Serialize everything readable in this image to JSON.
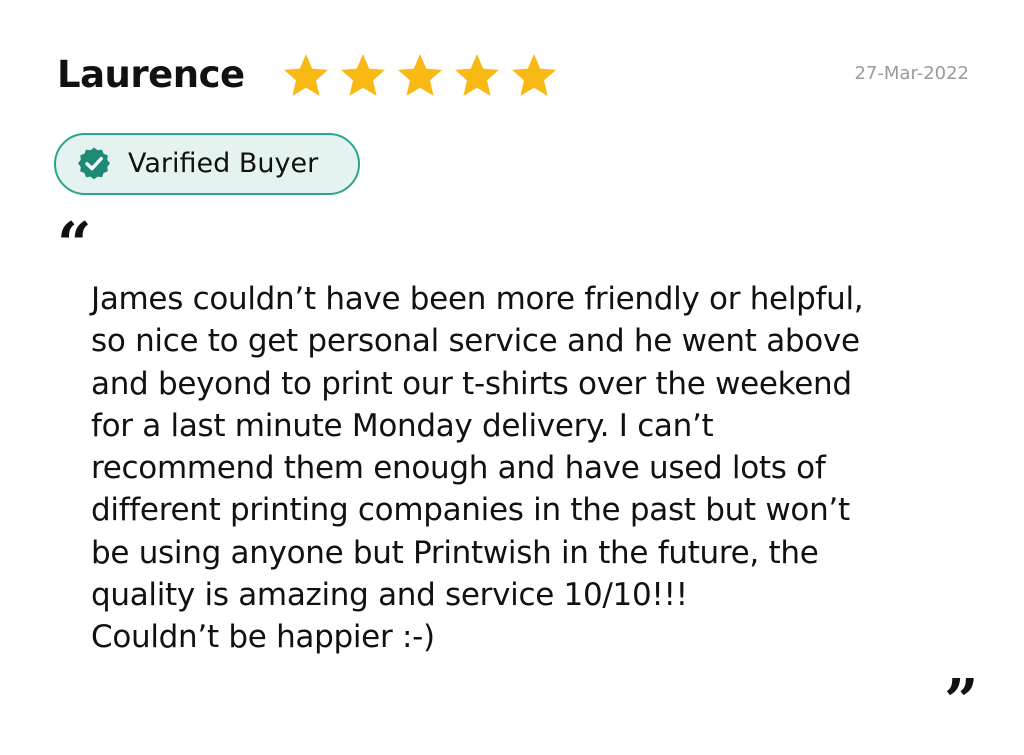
{
  "review": {
    "reviewer_name": "Laurence",
    "rating": 5,
    "rating_max": 5,
    "date": "27-Mar-2022",
    "badge_label": "Varified Buyer",
    "quote_open": "“",
    "quote_close": "”",
    "text_lines": [
      "James couldn’t have been more friendly or helpful,",
      "so nice to get personal service and he went above",
      "and beyond to print our t-shirts over the weekend",
      "for a last minute Monday delivery. I can’t",
      "recommend them enough and have used lots of",
      "different printing companies in the past but won’t",
      "be using anyone but Printwish in the future, the",
      "quality is amazing and service 10/10!!!",
      "Couldn’t be happier :-)"
    ]
  },
  "icons": {
    "star": "star-icon",
    "badge": "verified-check-icon"
  },
  "colors": {
    "star": "#f9b915",
    "badge_border": "#2aa58c",
    "badge_fill": "#e4f3ef",
    "badge_icon": "#1f8a74",
    "date_text": "#9a9a9a",
    "text": "#111111"
  }
}
